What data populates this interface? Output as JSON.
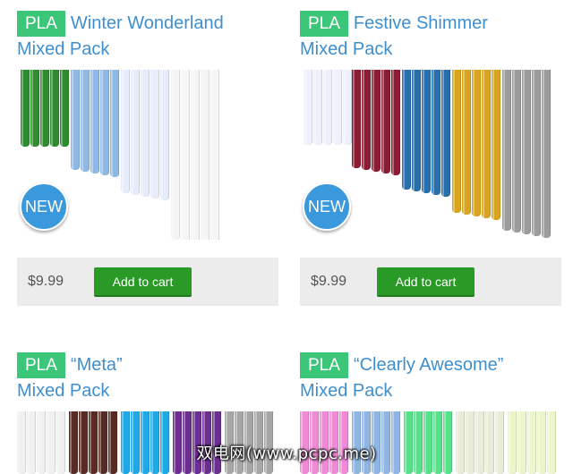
{
  "products": [
    {
      "badge": "PLA",
      "name": "Winter Wonderland",
      "subtitle": "Mixed Pack",
      "new_label": "NEW",
      "price": "$9.99",
      "button_label": "Add to cart",
      "filament_colors": [
        "#2e8b2e",
        "#8fb8e4",
        "#e6ecfa",
        "#f5f5f5"
      ]
    },
    {
      "badge": "PLA",
      "name": "Festive Shimmer",
      "subtitle": "Mixed Pack",
      "new_label": "NEW",
      "price": "$9.99",
      "button_label": "Add to cart",
      "filament_colors": [
        "#eef1fb",
        "#8c1c34",
        "#2a6fad",
        "#d9a521",
        "#9c9c9c"
      ]
    },
    {
      "badge": "PLA",
      "name": "“Meta”",
      "subtitle": "Mixed Pack",
      "filament_colors": [
        "#f0f0f0",
        "#5a2b24",
        "#1fa8e6",
        "#6c2e91",
        "#a6a6a6"
      ]
    },
    {
      "badge": "PLA",
      "name": "“Clearly Awesome”",
      "subtitle": "Mixed Pack",
      "filament_colors": [
        "#f08ad6",
        "#8fb6e2",
        "#56e08a",
        "#e8ecd8",
        "#eaf5c9"
      ]
    }
  ],
  "watermark": "双电网(www.pcpc.me)",
  "colors": {
    "badge_green": "#3cc679",
    "link_blue": "#3f8fcf",
    "button_green": "#2a9a27",
    "new_badge_blue": "#3a98dc",
    "price_bar_gray": "#ececec"
  }
}
